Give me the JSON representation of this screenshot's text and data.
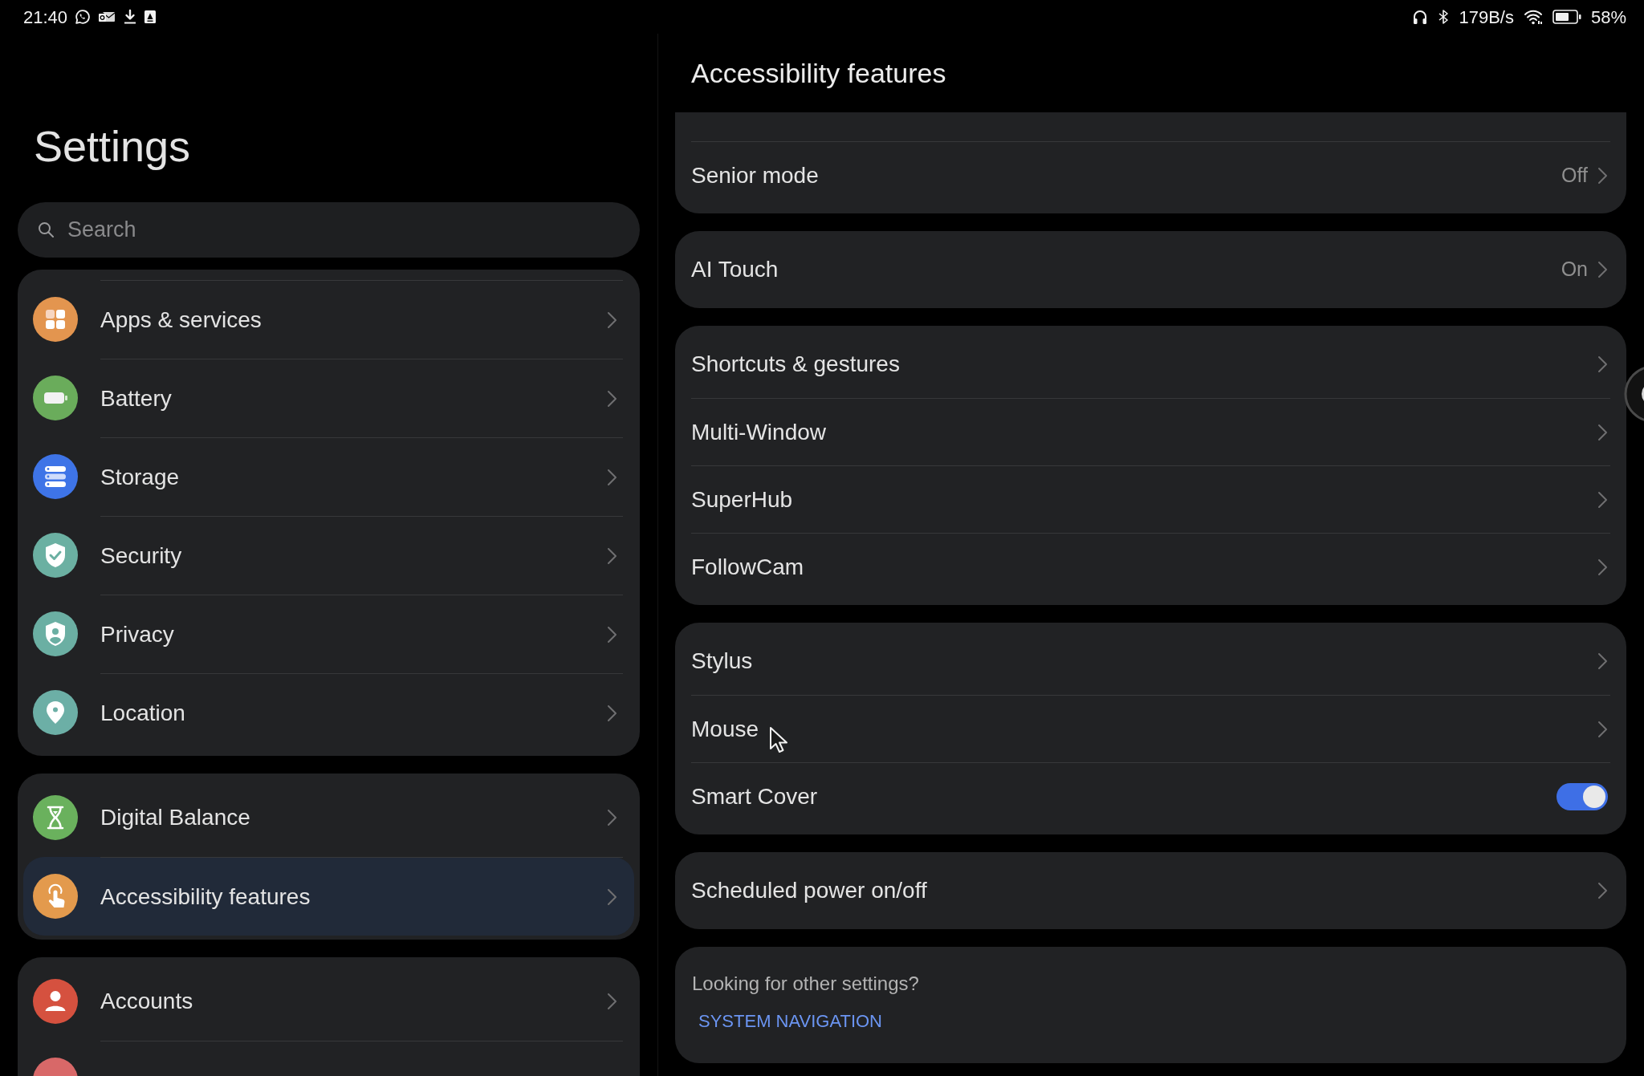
{
  "status_bar": {
    "time": "21:40",
    "network_speed": "179B/s",
    "battery_percent": "58%"
  },
  "sidebar": {
    "title": "Settings",
    "search": {
      "placeholder": "Search"
    },
    "groups": [
      {
        "items": [
          {
            "label": "Apps & services",
            "color": "#e3954f",
            "selected": false
          },
          {
            "label": "Battery",
            "color": "#6aac5b",
            "selected": false
          },
          {
            "label": "Storage",
            "color": "#3e74e7",
            "selected": false
          },
          {
            "label": "Security",
            "color": "#6bb0a2",
            "selected": false
          },
          {
            "label": "Privacy",
            "color": "#6bafa3",
            "selected": false
          },
          {
            "label": "Location",
            "color": "#6cafa6",
            "selected": false
          }
        ]
      },
      {
        "items": [
          {
            "label": "Digital Balance",
            "color": "#6ab15d",
            "selected": false
          },
          {
            "label": "Accessibility features",
            "color": "#e39a4d",
            "selected": true
          }
        ]
      },
      {
        "items": [
          {
            "label": "Accounts",
            "color": "#d5513f",
            "selected": false
          },
          {
            "color": "#d86868",
            "selected": false
          }
        ]
      }
    ]
  },
  "detail": {
    "title": "Accessibility features",
    "groups": [
      {
        "rows": [
          {
            "kind": "nav",
            "label": "Senior mode",
            "value": "Off"
          }
        ]
      },
      {
        "rows": [
          {
            "kind": "nav",
            "label": "AI Touch",
            "value": "On"
          }
        ]
      },
      {
        "rows": [
          {
            "kind": "nav",
            "label": "Shortcuts & gestures"
          },
          {
            "kind": "nav",
            "label": "Multi-Window"
          },
          {
            "kind": "nav",
            "label": "SuperHub"
          },
          {
            "kind": "nav",
            "label": "FollowCam"
          }
        ]
      },
      {
        "rows": [
          {
            "kind": "nav",
            "label": "Stylus"
          },
          {
            "kind": "nav",
            "label": "Mouse"
          },
          {
            "kind": "switch",
            "label": "Smart Cover",
            "on": true
          }
        ]
      },
      {
        "rows": [
          {
            "kind": "nav",
            "label": "Scheduled power on/off"
          }
        ]
      }
    ],
    "footer": {
      "prompt": "Looking for other settings?",
      "link": "SYSTEM NAVIGATION"
    }
  }
}
